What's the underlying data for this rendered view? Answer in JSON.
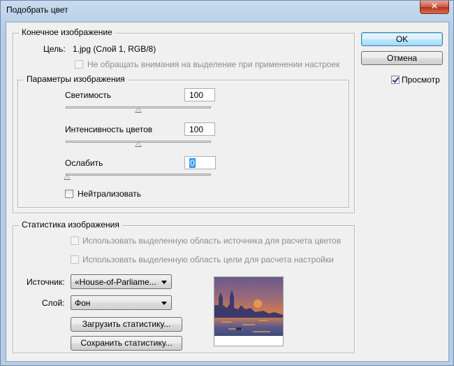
{
  "window": {
    "title": "Подобрать цвет",
    "close_glyph": "✕"
  },
  "buttons": {
    "ok": "OK",
    "cancel": "Отмена",
    "preview": "Просмотр",
    "preview_checked": true
  },
  "target_image": {
    "legend": "Конечное изображение",
    "target_label": "Цель:",
    "target_value": "1.jpg (Слой 1, RGB/8)",
    "ignore_selection": "Не обращать внимания на выделение при применении настроек"
  },
  "image_options": {
    "legend": "Параметры изображения",
    "luminance": {
      "label": "Светимость",
      "value": "100",
      "slider_fraction": 0.5
    },
    "color_intensity": {
      "label": "Интенсивность цветов",
      "value": "100",
      "slider_fraction": 0.5
    },
    "fade": {
      "label": "Ослабить",
      "value": "0",
      "slider_fraction": 0.0
    },
    "neutralize": "Нейтрализовать"
  },
  "image_statistics": {
    "legend": "Статистика изображения",
    "use_source_selection": "Использовать выделенную область источника для расчета цветов",
    "use_target_selection": "Использовать выделенную область цели для расчета настройки",
    "source_label": "Источник:",
    "source_value": "«House-of-Parliame...",
    "layer_label": "Слой:",
    "layer_value": "Фон",
    "load_stats": "Загрузить статистику...",
    "save_stats": "Сохранить статистику..."
  },
  "colors": {
    "dialog_bg": "#f0f0f0",
    "disabled_text": "#8d8d8d",
    "selection": "#3399ff"
  },
  "icons": {
    "close": "close-icon",
    "dropdown": "chevron-down-icon"
  }
}
